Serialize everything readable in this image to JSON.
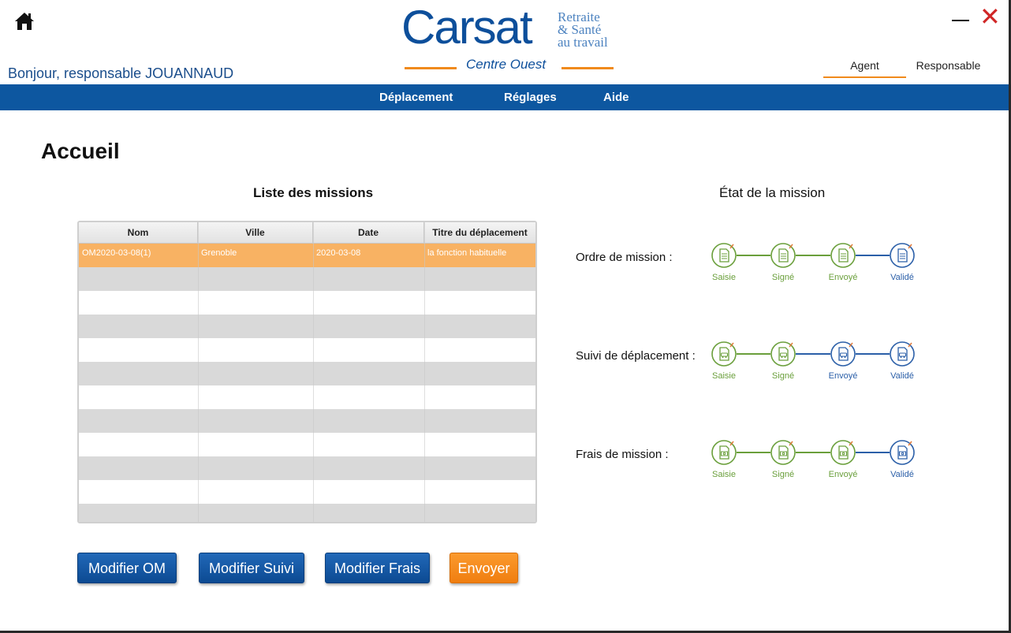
{
  "header": {
    "greeting": "Bonjour, responsable JOUANNAUD",
    "logo": {
      "main": "Carsat",
      "side_line1": "Retraite",
      "side_line2": "& Santé",
      "side_line3": "au travail",
      "sub": "Centre Ouest"
    },
    "roles": [
      "Agent",
      "Responsable"
    ],
    "active_role": "Agent"
  },
  "nav": {
    "items": [
      "Déplacement",
      "Réglages",
      "Aide"
    ]
  },
  "page": {
    "title": "Accueil",
    "list_title": "Liste des missions",
    "state_title": "État de la mission"
  },
  "table": {
    "columns": [
      "Nom",
      "Ville",
      "Date",
      "Titre du déplacement"
    ],
    "rows": [
      [
        "OM2020-03-08(1)",
        "Grenoble",
        "2020-03-08",
        "la fonction habituelle"
      ]
    ],
    "selected_row": 0
  },
  "buttons": {
    "modifier_om": "Modifier OM",
    "modifier_suivi": "Modifier Suivi",
    "modifier_frais": "Modifier Frais",
    "envoyer": "Envoyer"
  },
  "mission_state": {
    "steps": [
      "Saisie",
      "Signé",
      "Envoyé",
      "Validé"
    ],
    "rows": [
      {
        "label": "Ordre de mission :",
        "icon": "document-icon",
        "completed": 3
      },
      {
        "label": "Suivi de déplacement :",
        "icon": "car-document-icon",
        "completed": 2
      },
      {
        "label": "Frais de mission :",
        "icon": "money-document-icon",
        "completed": 3
      }
    ]
  },
  "colors": {
    "brand_blue": "#0d57a0",
    "accent_orange": "#f08a1c",
    "done_green": "#6a9f3b",
    "pending_blue": "#2b5fa8",
    "selected_row": "#f8b263"
  }
}
